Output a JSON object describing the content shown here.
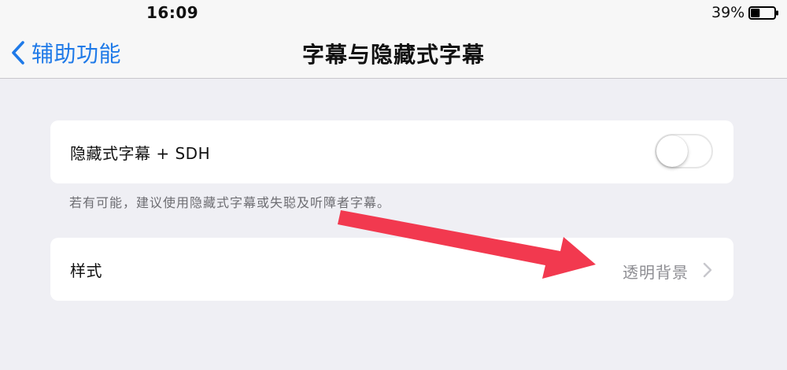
{
  "status_bar": {
    "time": "16:09",
    "battery_percent": "39%",
    "battery_level": 0.39
  },
  "nav": {
    "back_label": "辅助功能",
    "title": "字幕与隐藏式字幕"
  },
  "settings": {
    "closed_captions": {
      "label": "隐藏式字幕 + SDH",
      "enabled": false,
      "footer": "若有可能，建议使用隐藏式字幕或失聪及听障者字幕。"
    },
    "style": {
      "label": "样式",
      "value": "透明背景"
    }
  },
  "colors": {
    "accent": "#1f7ae8",
    "annotation_arrow": "#f2394f",
    "background": "#efeff4"
  },
  "icons": {
    "back": "chevron-left-icon",
    "disclosure": "chevron-right-icon",
    "battery": "battery-icon",
    "annotation": "red-arrow-annotation"
  }
}
